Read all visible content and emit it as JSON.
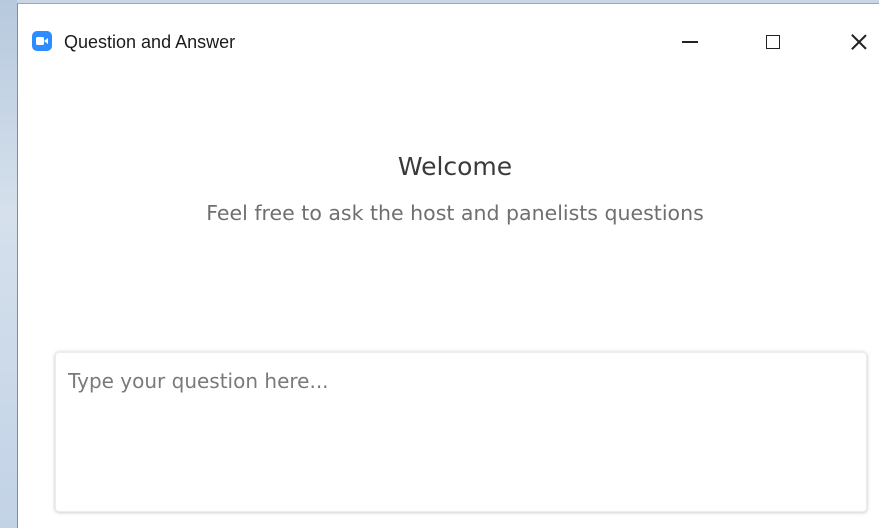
{
  "window": {
    "title": "Question and Answer",
    "app_icon": "zoom-camera-icon",
    "controls": {
      "minimize": "minimize-icon",
      "maximize": "maximize-icon",
      "close": "close-icon"
    }
  },
  "main": {
    "heading": "Welcome",
    "subheading": "Feel free to ask the host and panelists questions"
  },
  "question": {
    "placeholder": "Type your question here...",
    "value": ""
  },
  "colors": {
    "accent": "#2d8cff",
    "heading_text": "#3a3a3a",
    "subtitle_text": "#6f6f6f"
  }
}
